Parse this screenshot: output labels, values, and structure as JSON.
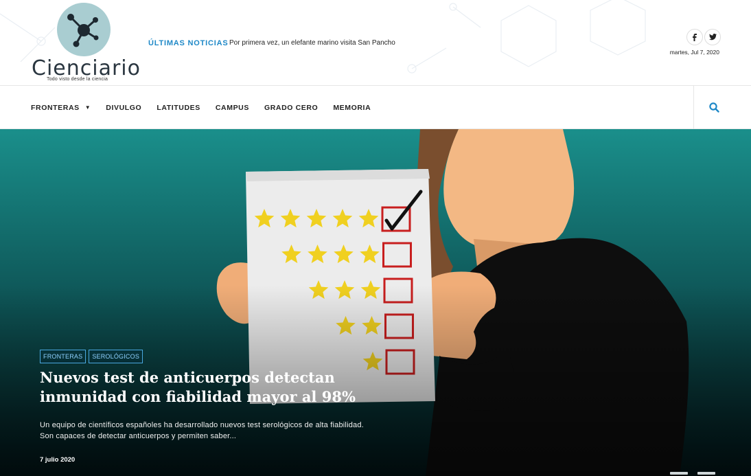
{
  "site": {
    "name": "Cienciario",
    "tagline": "Todo visto desde la ciencia"
  },
  "breaking": {
    "label": "ÚLTIMAS NOTICIAS",
    "headline": "Por primera vez, un elefante marino visita San Pancho"
  },
  "header": {
    "date": "martes, Jul 7, 2020",
    "social": [
      {
        "name": "facebook-icon",
        "glyph": "f"
      },
      {
        "name": "twitter-icon",
        "glyph": "t"
      }
    ]
  },
  "nav": {
    "items": [
      {
        "label": "FRONTERAS",
        "has_dropdown": true
      },
      {
        "label": "DIVULGO"
      },
      {
        "label": "LATITUDES"
      },
      {
        "label": "CAMPUS"
      },
      {
        "label": "GRADO CERO"
      },
      {
        "label": "MEMORIA"
      }
    ],
    "search_icon": "search-icon"
  },
  "hero": {
    "tags": [
      "FRONTERAS",
      "SEROLÓGICOS"
    ],
    "title": "Nuevos test de anticuerpos detectan inmunidad con fiabilidad mayor al 98%",
    "excerpt": "Un equipo de científicos españoles ha desarrollado nuevos test serológicos de alta fiabilidad. Son capaces de detectar anticuerpos y permiten saber...",
    "date": "7 julio 2020",
    "rating_card": {
      "rows": [
        5,
        4,
        3,
        2,
        1
      ],
      "checked_row": 5
    }
  },
  "colors": {
    "accent": "#1e88c7",
    "logo_circle": "#a9cdd1",
    "hero_top": "#1a8f8b",
    "hero_bottom": "#02181b",
    "star": "#f0d020",
    "checkbox": "#c81e1e"
  }
}
